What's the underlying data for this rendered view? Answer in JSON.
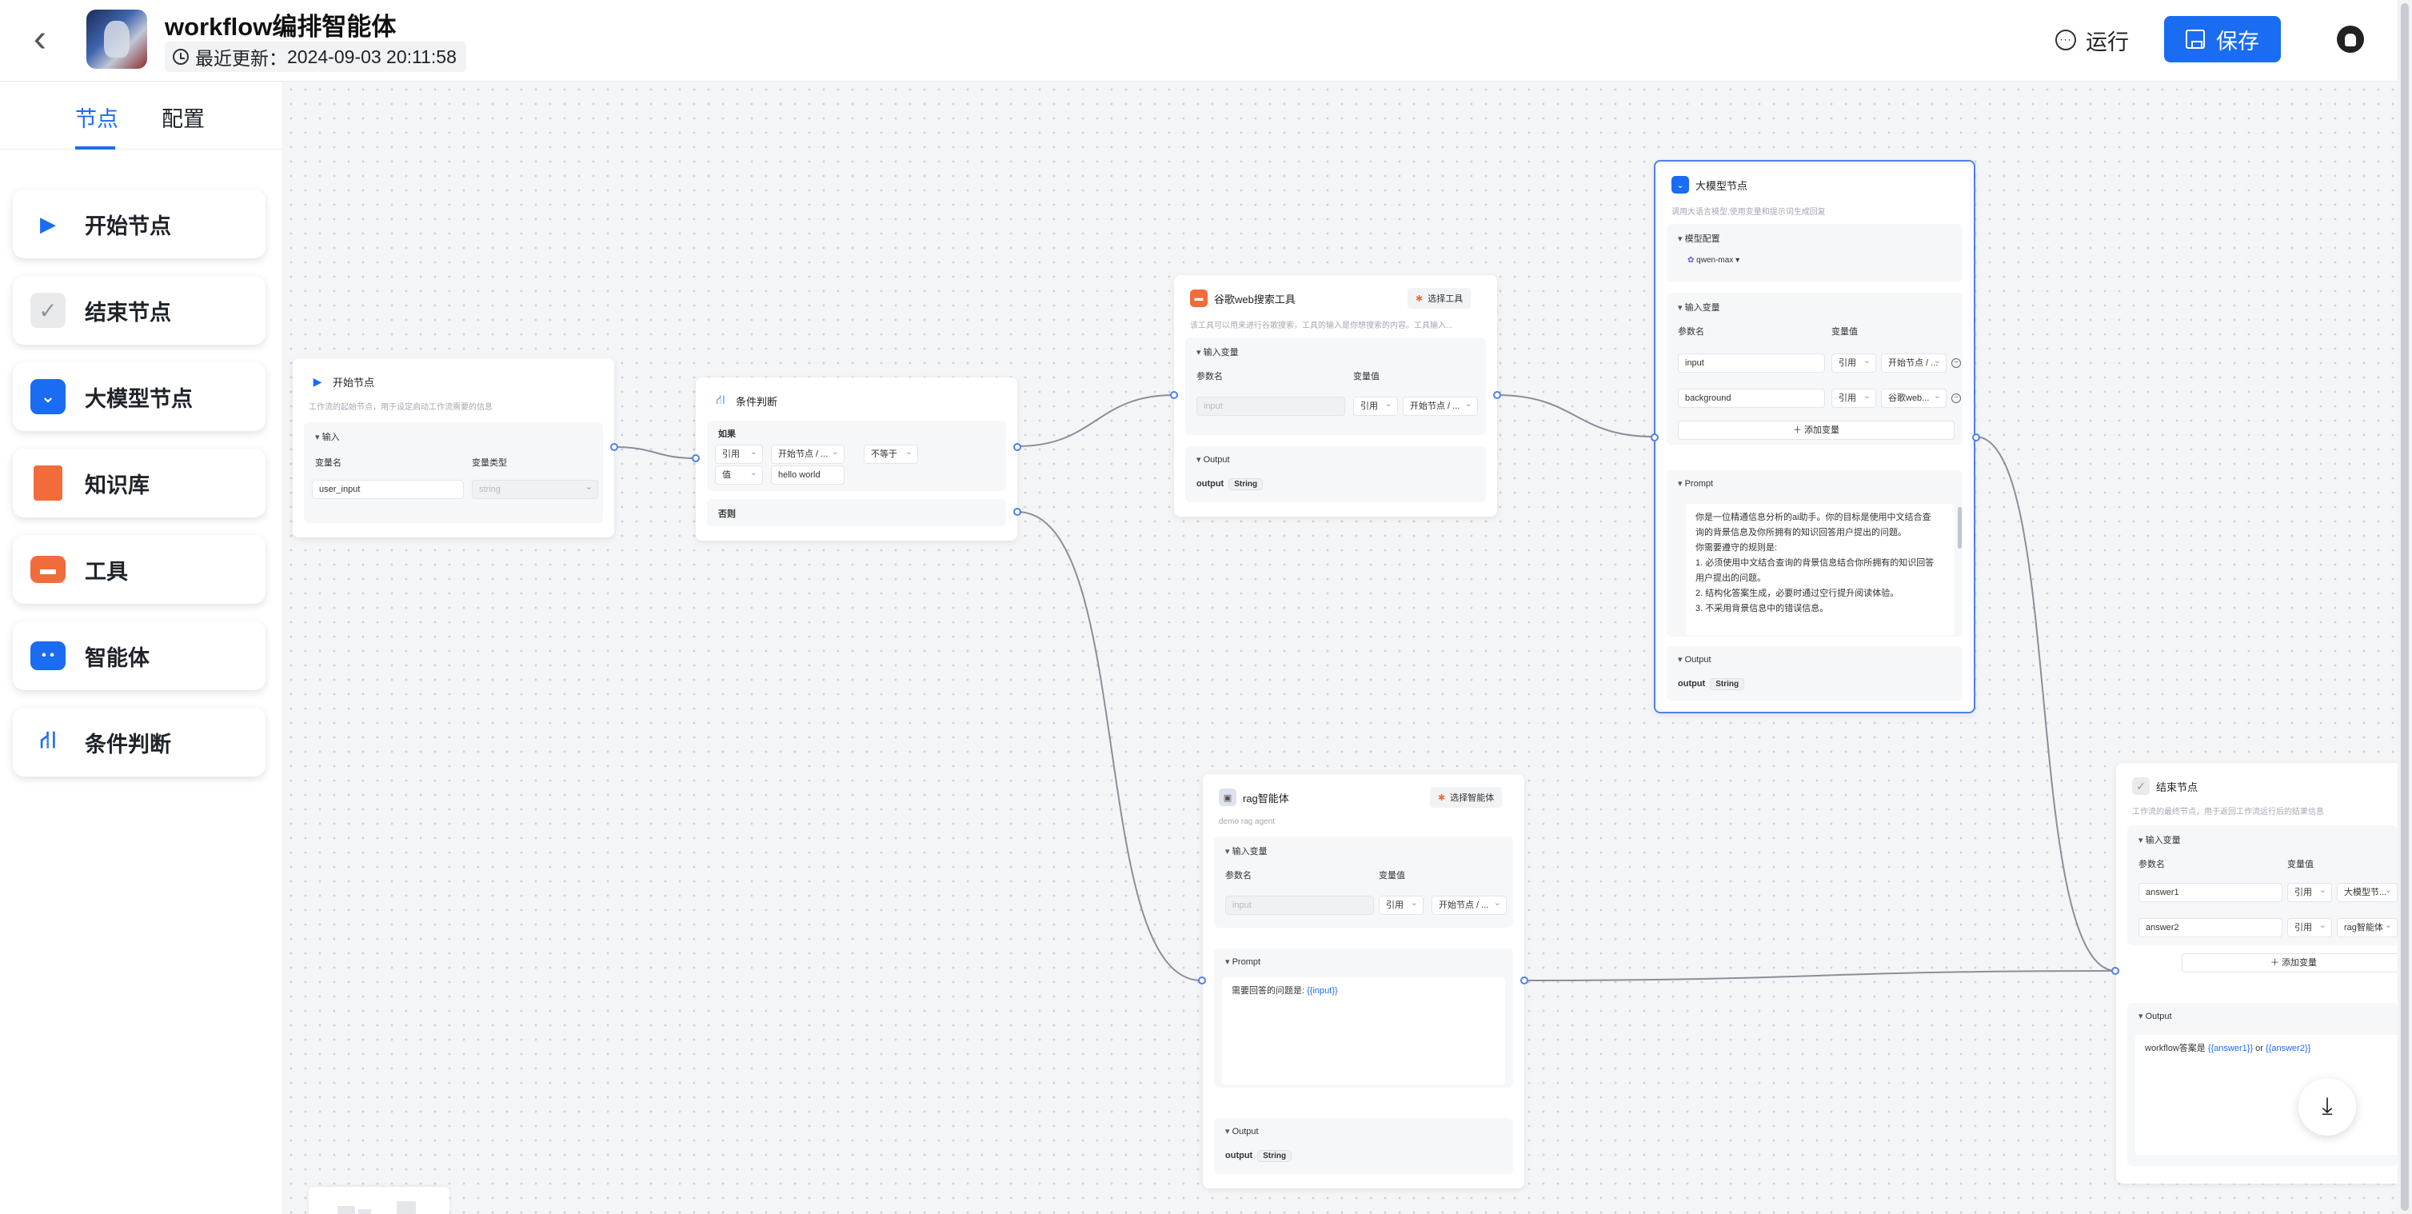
{
  "header": {
    "app_title": "workflow编排智能体",
    "updated_label": "最近更新：",
    "updated_time": "2024-09-03 20:11:58",
    "run_label": "运行",
    "save_label": "保存"
  },
  "sidebar": {
    "tabs": [
      {
        "label": "节点",
        "active": true
      },
      {
        "label": "配置",
        "active": false
      }
    ],
    "items": [
      {
        "label": "开始节点",
        "icon": "play-icon",
        "color": "#1a6cf2"
      },
      {
        "label": "结束节点",
        "icon": "check-icon",
        "color": "#8f959e"
      },
      {
        "label": "大模型节点",
        "icon": "llm-icon",
        "color": "#1a6cf2"
      },
      {
        "label": "知识库",
        "icon": "book-icon",
        "color": "#f06c3b"
      },
      {
        "label": "工具",
        "icon": "toolbox-icon",
        "color": "#f06c3b"
      },
      {
        "label": "智能体",
        "icon": "robot-icon",
        "color": "#1a6cf2"
      },
      {
        "label": "条件判断",
        "icon": "branch-icon",
        "color": "#1a6cf2"
      }
    ]
  },
  "nodes": {
    "start": {
      "title": "开始节点",
      "desc": "工作流的起始节点，用于设定启动工作流需要的信息",
      "section": "输入",
      "col_name": "变量名",
      "col_type": "变量类型",
      "var_name": "user_input",
      "var_type": "string"
    },
    "condition": {
      "title": "条件判断",
      "if_label": "如果",
      "ref": "引用",
      "source": "开始节点 / ...",
      "op": "不等于",
      "value_type": "值",
      "value": "hello world",
      "else_label": "否则"
    },
    "google": {
      "title": "谷歌web搜索工具",
      "select_label": "选择工具",
      "desc": "该工具可以用来进行谷歌搜索，工具的输入是你想搜索的内容。工具输入...",
      "input_section": "输入变量",
      "col_param": "参数名",
      "col_value": "变量值",
      "param": "input",
      "ref": "引用",
      "source": "开始节点 / ...",
      "output_section": "Output",
      "output_name": "output",
      "output_type": "String"
    },
    "llm": {
      "title": "大模型节点",
      "desc": "调用大语言模型,使用变量和提示词生成回复",
      "model_section": "模型配置",
      "model": "qwen-max",
      "input_section": "输入变量",
      "col_param": "参数名",
      "col_value": "变量值",
      "params": [
        {
          "name": "input",
          "ref": "引用",
          "source": "开始节点 / ..."
        },
        {
          "name": "background",
          "ref": "引用",
          "source": "谷歌web..."
        }
      ],
      "add_var": "添加变量",
      "prompt_section": "Prompt",
      "prompt_lines": [
        "你是一位精通信息分析的ai助手。你的目标是使用中文结合查",
        "询的背景信息及你所拥有的知识回答用户提出的问题。",
        "你需要遵守的规则是:",
        "1. 必须使用中文结合查询的背景信息结合你所拥有的知识回答",
        "用户提出的问题。",
        "2. 结构化答案生成，必要时通过空行提升阅读体验。",
        "3. 不采用背景信息中的错误信息。"
      ],
      "output_section": "Output",
      "output_name": "output",
      "output_type": "String"
    },
    "rag": {
      "title": "rag智能体",
      "select_label": "选择智能体",
      "desc": "demo rag agent",
      "input_section": "输入变量",
      "col_param": "参数名",
      "col_value": "变量值",
      "param": "input",
      "ref": "引用",
      "source": "开始节点 / ...",
      "prompt_section": "Prompt",
      "prompt_text": "需要回答的问题是: ",
      "prompt_var": "{{input}}",
      "output_section": "Output",
      "output_name": "output",
      "output_type": "String"
    },
    "end": {
      "title": "结束节点",
      "desc": "工作流的最终节点，用于返回工作流运行后的结果信息",
      "input_section": "输入变量",
      "col_param": "参数名",
      "col_value": "变量值",
      "params": [
        {
          "name": "answer1",
          "ref": "引用",
          "source": "大模型节..."
        },
        {
          "name": "answer2",
          "ref": "引用",
          "source": "rag智能体"
        }
      ],
      "add_var": "添加变量",
      "output_section": "Output",
      "output_text": "workflow答案是 ",
      "output_var1": "{{answer1}}",
      "output_or": " or ",
      "output_var2": "{{answer2}}"
    }
  },
  "colors": {
    "accent": "#1a6cf2",
    "tool": "#f06c3b",
    "edge": "#8a8f99"
  }
}
